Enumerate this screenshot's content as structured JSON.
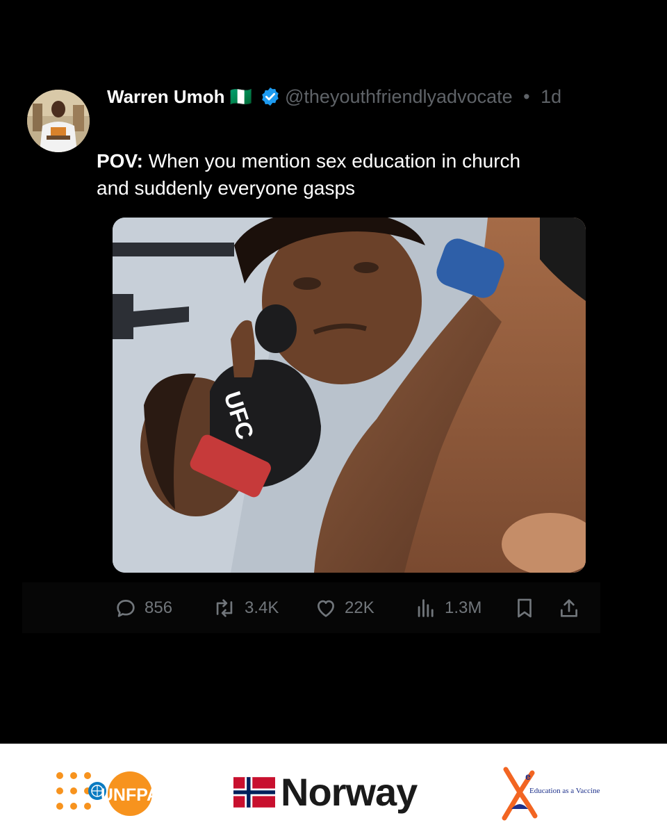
{
  "post": {
    "author_name": "Warren Umoh 🇳🇬",
    "handle": "@theyouthfriendlyadvocate",
    "separator": "•",
    "time": "1d",
    "text_bold": "POV:",
    "text_line1": " When you mention sex education in church",
    "text_line2": "and suddenly everyone gasps"
  },
  "media": {
    "glove_text": "UFC"
  },
  "actions": {
    "replies": "856",
    "reposts": "3.4K",
    "likes": "22K",
    "views": "1.3M"
  },
  "footer": {
    "logo1_text": "UNFPA",
    "logo2_text": "Norway",
    "logo3_letter": "e",
    "logo3_text": "Education as a Vaccine"
  },
  "colors": {
    "background": "#000000",
    "muted": "#71767b",
    "verified": "#1d9bf0",
    "unfpa_orange": "#f7931e",
    "norway_red": "#c8102e",
    "norway_blue": "#00205b",
    "eav_orange": "#f26522",
    "eav_blue": "#1b2f8a"
  }
}
